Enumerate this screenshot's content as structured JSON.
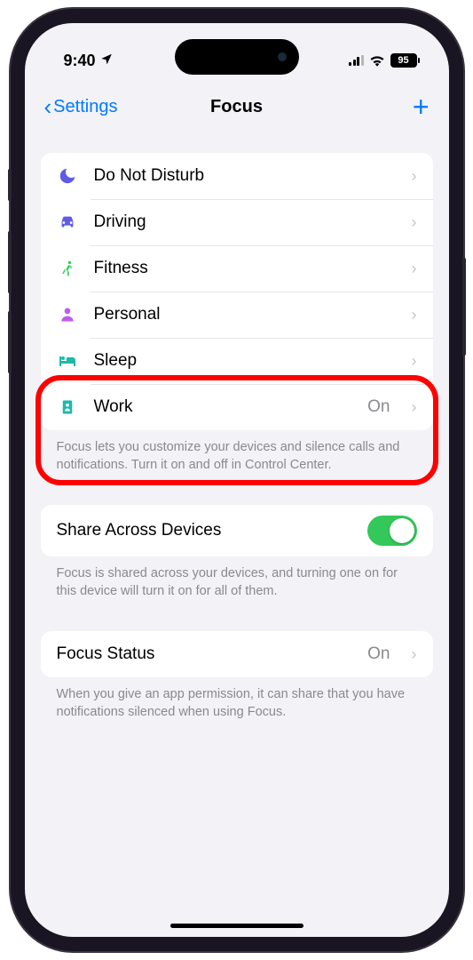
{
  "status_bar": {
    "time": "9:40",
    "battery": "95"
  },
  "nav": {
    "back_label": "Settings",
    "title": "Focus"
  },
  "focus_modes": [
    {
      "icon": "moon",
      "color": "#5e5ce6",
      "label": "Do Not Disturb",
      "value": ""
    },
    {
      "icon": "car",
      "color": "#5e5ce6",
      "label": "Driving",
      "value": ""
    },
    {
      "icon": "runner",
      "color": "#30d158",
      "label": "Fitness",
      "value": ""
    },
    {
      "icon": "person",
      "color": "#bf5af2",
      "label": "Personal",
      "value": ""
    },
    {
      "icon": "bed",
      "color": "#1db9a9",
      "label": "Sleep",
      "value": ""
    },
    {
      "icon": "badge",
      "color": "#1db9a9",
      "label": "Work",
      "value": "On"
    }
  ],
  "modes_footer": "Focus lets you customize your devices and silence calls and notifications. Turn it on and off in Control Center.",
  "share": {
    "label": "Share Across Devices",
    "enabled": true,
    "footer": "Focus is shared across your devices, and turning one on for this device will turn it on for all of them."
  },
  "focus_status": {
    "label": "Focus Status",
    "value": "On",
    "footer": "When you give an app permission, it can share that you have notifications silenced when using Focus."
  }
}
